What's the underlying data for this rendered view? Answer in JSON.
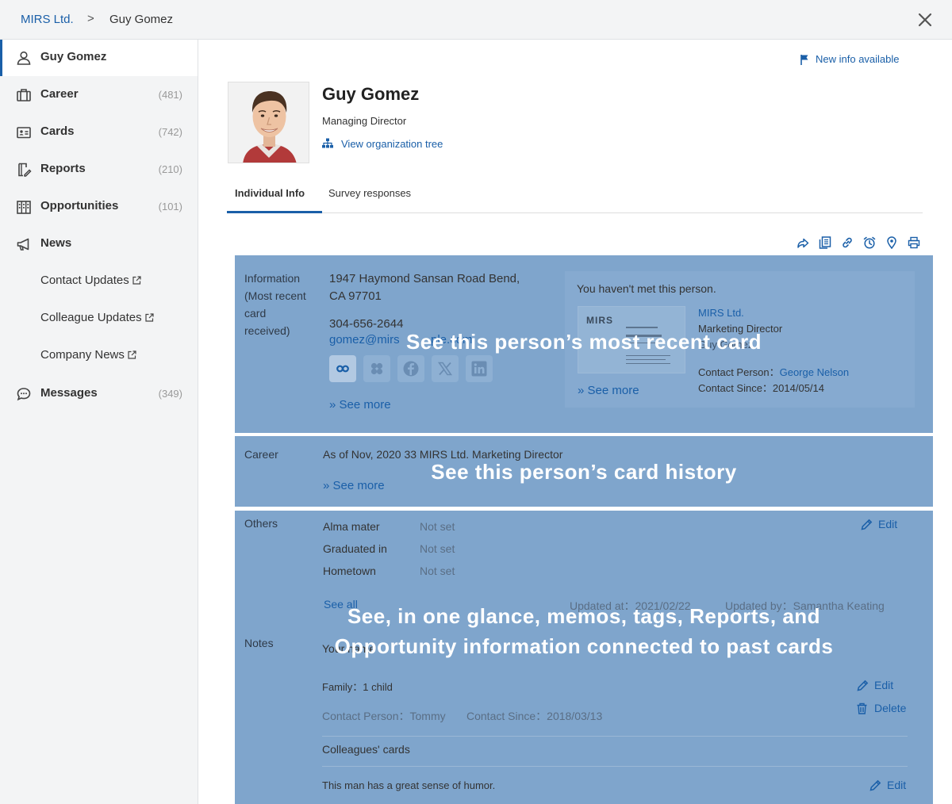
{
  "breadcrumb": {
    "company": "MIRS Ltd.",
    "separator": ">",
    "current": "Guy Gomez"
  },
  "sidebar": {
    "items": [
      {
        "label": "Guy Gomez",
        "count": "",
        "icon": "person-icon"
      },
      {
        "label": "Career",
        "count": "(481)",
        "icon": "briefcase-icon"
      },
      {
        "label": "Cards",
        "count": "(742)",
        "icon": "card-icon"
      },
      {
        "label": "Reports",
        "count": "(210)",
        "icon": "report-icon"
      },
      {
        "label": "Opportunities",
        "count": "(101)",
        "icon": "building-icon"
      },
      {
        "label": "News",
        "count": "",
        "icon": "megaphone-icon"
      },
      {
        "label": "Messages",
        "count": "(349)",
        "icon": "chat-bubble-icon"
      }
    ],
    "news_links": [
      "Contact Updates",
      "Colleague Updates",
      "Company News"
    ]
  },
  "header": {
    "new_info": "New info available",
    "name": "Guy Gomez",
    "title": "Managing Director",
    "org_tree": "View organization tree"
  },
  "tabs": [
    "Individual Info",
    "Survey responses"
  ],
  "info": {
    "label_lines": [
      "Information",
      "(Most recent",
      "card",
      "received)"
    ],
    "address_line1": "1947 Haymond Sansan Road Bend,",
    "address_line2": "CA 97701",
    "phone": "304-656-2644",
    "email": "gomez@mirs",
    "email_tail": "ple.com",
    "see_more": "» See more",
    "not_met": "You haven't met this person.",
    "card_company": "MIRS Ltd.",
    "card_position": "Marketing Director",
    "card_name_partial": "Guy Gomez",
    "contact_person_label": "Contact Person：",
    "contact_person": "George Nelson",
    "contact_since": "Contact Since：2014/05/14",
    "card_see_more": "» See more",
    "biz_card_brand": "MIRS"
  },
  "career": {
    "label": "Career",
    "text": "As of Nov, 2020 33 MIRS Ltd. Marketing Director",
    "see_more": "» See more"
  },
  "others": {
    "label": "Others",
    "rows": [
      {
        "key": "Alma mater",
        "value": "Not set"
      },
      {
        "key": "Graduated in",
        "value": "Not set"
      },
      {
        "key": "Hometown",
        "value": "Not set"
      }
    ],
    "edit": "Edit",
    "see_all": "See all",
    "updated_at": "Updated at：2021/02/22",
    "updated_by": "Updated by：Samantha Keating"
  },
  "notes": {
    "label": "Notes",
    "heading_partial": "Your name",
    "family": "Family：1 child",
    "contact_person": "Contact Person：Tommy",
    "contact_since": "Contact Since：2018/03/13",
    "edit": "Edit",
    "delete": "Delete",
    "colleagues_heading": "Colleagues' cards",
    "humor": "This man has a great sense of humor.",
    "edit2": "Edit"
  },
  "overlays": {
    "recent_card": "See this person’s most recent card",
    "card_history": "See this person’s card history",
    "glance_line1": "See, in one glance, memos, tags, Reports, and",
    "glance_line2": "Opportunity information connected to past cards"
  },
  "colors": {
    "accent": "#1a5fa8",
    "overlay": "#7fa5cc",
    "sidebar_bg": "#f3f4f5"
  }
}
